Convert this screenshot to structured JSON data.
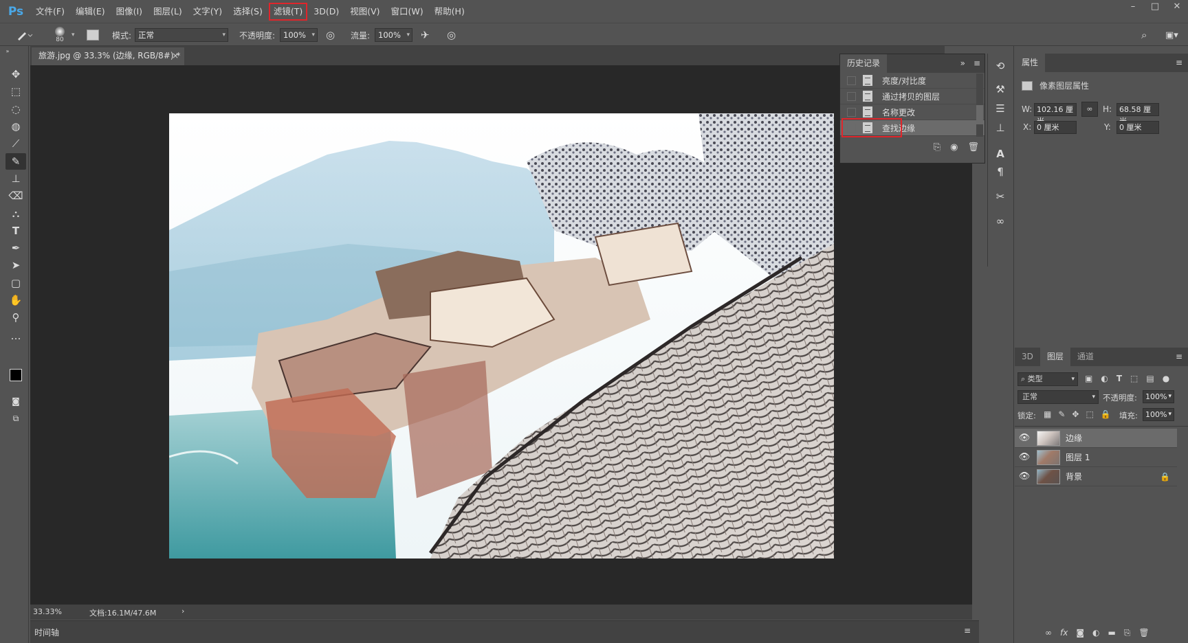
{
  "app": {
    "logo": "Ps"
  },
  "menu": [
    "文件(F)",
    "编辑(E)",
    "图像(I)",
    "图层(L)",
    "文字(Y)",
    "选择(S)",
    "滤镜(T)",
    "3D(D)",
    "视图(V)",
    "窗口(W)",
    "帮助(H)"
  ],
  "menu_highlight_index": 6,
  "window_controls": [
    "–",
    "□",
    "✕"
  ],
  "options": {
    "brush_size": "80",
    "mode_label": "模式:",
    "mode_value": "正常",
    "opacity_label": "不透明度:",
    "opacity_value": "100%",
    "flow_label": "流量:",
    "flow_value": "100%"
  },
  "document": {
    "tab_title": "旅游.jpg @ 33.3% (边缘, RGB/8#) *",
    "close": "×",
    "zoom": "33.33%",
    "doc_info": "文档:16.1M/47.6M",
    "arrow": "›"
  },
  "timeline": {
    "label": "时间轴"
  },
  "history": {
    "tab": "历史记录",
    "items": [
      {
        "label": "亮度/对比度",
        "selected": false
      },
      {
        "label": "通过拷贝的图层",
        "selected": false
      },
      {
        "label": "名称更改",
        "selected": false
      },
      {
        "label": "查找边缘",
        "selected": true
      }
    ]
  },
  "properties": {
    "tab": "属性",
    "title": "像素图层属性",
    "w_label": "W:",
    "w_value": "102.16 厘米",
    "h_label": "H:",
    "h_value": "68.58 厘米",
    "x_label": "X:",
    "x_value": "0 厘米",
    "y_label": "Y:",
    "y_value": "0 厘米"
  },
  "layers": {
    "tabs": [
      "3D",
      "图层",
      "通道"
    ],
    "active_tab": 1,
    "filter_label": "类型",
    "blend_mode": "正常",
    "opacity_label": "不透明度:",
    "opacity_value": "100%",
    "lock_label": "锁定:",
    "fill_label": "填充:",
    "fill_value": "100%",
    "items": [
      {
        "name": "边缘",
        "selected": true,
        "locked": false
      },
      {
        "name": "图层 1",
        "selected": false,
        "locked": false
      },
      {
        "name": "背景",
        "selected": false,
        "locked": true
      }
    ]
  },
  "colors": {
    "accent_red": "#e0252b",
    "ps_blue": "#4aa8e8"
  }
}
